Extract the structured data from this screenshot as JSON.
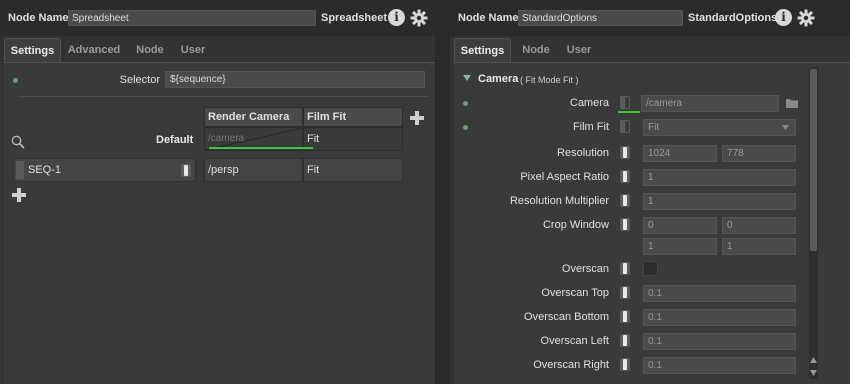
{
  "left": {
    "node_name_label": "Node Name",
    "node_name_value": "Spreadsheet",
    "node_type": "Spreadsheet",
    "tabs": [
      {
        "label": "Settings",
        "active": true
      },
      {
        "label": "Advanced",
        "active": false
      },
      {
        "label": "Node",
        "active": false
      },
      {
        "label": "User",
        "active": false
      }
    ],
    "selector_label": "Selector",
    "selector_value": "${sequence}",
    "columns": [
      "Render Camera",
      "Film Fit"
    ],
    "default_label": "Default",
    "default_row": {
      "render_camera": "/camera",
      "film_fit": "Fit"
    },
    "rows": [
      {
        "name": "SEQ-1",
        "render_camera": "/persp",
        "film_fit": "Fit"
      }
    ]
  },
  "right": {
    "node_name_label": "Node Name",
    "node_name_value": "StandardOptions",
    "node_type": "StandardOptions",
    "tabs": [
      {
        "label": "Settings",
        "active": true
      },
      {
        "label": "Node",
        "active": false
      },
      {
        "label": "User",
        "active": false
      }
    ],
    "section_title": "Camera",
    "section_subtitle": "( Fit Mode Fit )",
    "props": {
      "camera": {
        "label": "Camera",
        "value": "/camera"
      },
      "film_fit": {
        "label": "Film Fit",
        "value": "Fit"
      },
      "resolution": {
        "label": "Resolution",
        "x": "1024",
        "y": "778"
      },
      "pixel_aspect_ratio": {
        "label": "Pixel Aspect Ratio",
        "value": "1"
      },
      "resolution_multiplier": {
        "label": "Resolution Multiplier",
        "value": "1"
      },
      "crop_window": {
        "label": "Crop Window",
        "min_x": "0",
        "min_y": "0",
        "max_x": "1",
        "max_y": "1"
      },
      "overscan": {
        "label": "Overscan"
      },
      "overscan_top": {
        "label": "Overscan Top",
        "value": "0.1"
      },
      "overscan_bottom": {
        "label": "Overscan Bottom",
        "value": "0.1"
      },
      "overscan_left": {
        "label": "Overscan Left",
        "value": "0.1"
      },
      "overscan_right": {
        "label": "Overscan Right",
        "value": "0.1"
      }
    }
  },
  "colors": {
    "panel_bg": "#333333",
    "content_bg": "#3a3a3a",
    "field_bg": "#4a4a4a",
    "accent_green": "#3ac43a"
  },
  "icons": [
    "info-icon",
    "gear-icon",
    "search-icon",
    "plus-icon",
    "folder-icon",
    "chevron-down-icon",
    "triangle-down-icon",
    "scroll-arrow-up-icon",
    "scroll-arrow-down-icon"
  ]
}
